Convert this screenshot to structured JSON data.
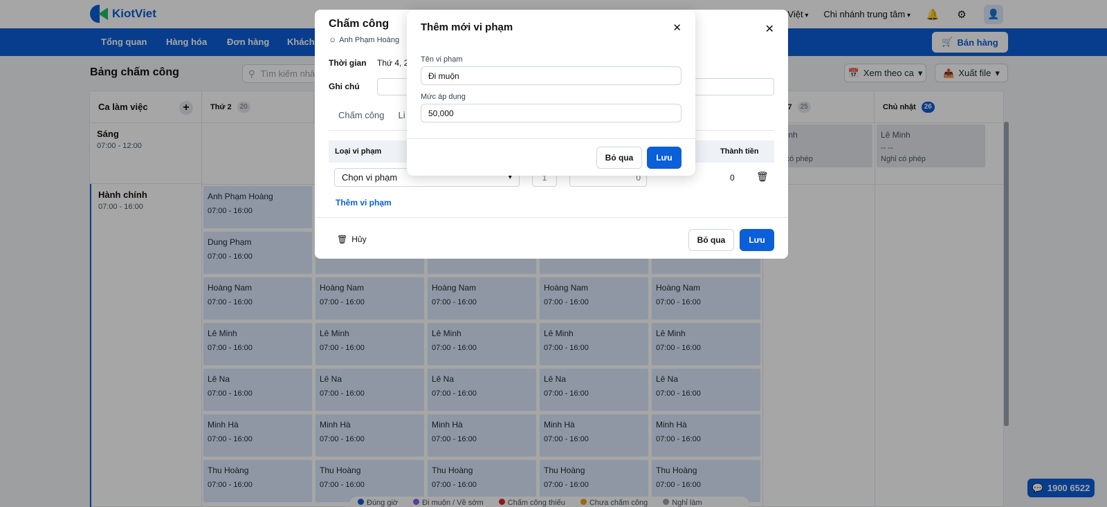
{
  "app": {
    "logo": "KiotViet"
  },
  "topbar": {
    "language": "Tiếng Việt",
    "branch": "Chi nhánh trung tâm"
  },
  "nav": {
    "items": [
      "Tổng quan",
      "Hàng hóa",
      "Đơn hàng",
      "Khách"
    ],
    "sell_label": "Bán hàng"
  },
  "page": {
    "title": "Bảng chấm công",
    "search_placeholder": "Tìm kiếm nhân viên",
    "view_label": "Xem theo ca",
    "export_label": "Xuất file"
  },
  "grid": {
    "shift_header": "Ca làm việc",
    "days": [
      {
        "label": "Thứ 2",
        "num": "20"
      },
      {
        "label": "Thứ 7",
        "num": "25"
      },
      {
        "label": "Chủ nhật",
        "num": "26"
      }
    ],
    "shifts": [
      {
        "name": "Sáng",
        "time": "07:00 - 12:00"
      },
      {
        "name": "Hành chính",
        "time": "07:00 - 16:00"
      }
    ],
    "morning_cells": [
      {
        "name": "Lê Minh",
        "dash": "-- --",
        "status": "Nghỉ có phép"
      },
      {
        "name": "Lê Minh",
        "dash": "-- --",
        "status": "Nghỉ có phép"
      }
    ],
    "employees": [
      "Anh Phạm Hoàng",
      "Dung Phạm",
      "Hoàng Nam",
      "Lê Minh",
      "Lê Na",
      "Minh Hà",
      "Thu Hoàng"
    ],
    "shift_time": "07:00 - 16:00"
  },
  "legend": [
    "Đúng giờ",
    "Đi muộn / Về sớm",
    "Chấm công thiếu",
    "Chưa chấm công",
    "Nghỉ làm"
  ],
  "hotline": "1900 6522",
  "timesheet_dialog": {
    "title": "Chấm công",
    "user": "Anh Phạm Hoàng",
    "time_label": "Thời gian",
    "time_value": "Thứ 4, 2",
    "note_label": "Ghi chú",
    "tabs": [
      "Chấm công",
      "Li"
    ],
    "col_type": "Loại vi phạm",
    "col_total": "Thành tiền",
    "select_placeholder": "Chọn vi phạm",
    "qty": "1",
    "amount": "0",
    "total": "0",
    "add_violation": "Thêm vi phạm",
    "cancel_label": "Hủy",
    "skip_label": "Bỏ qua",
    "save_label": "Lưu"
  },
  "violation_dialog": {
    "title": "Thêm mới vi phạm",
    "name_label": "Tên vi phạm",
    "name_value": "Đi muộn",
    "rate_label": "Mức áp dụng",
    "rate_value": "50,000",
    "skip_label": "Bỏ qua",
    "save_label": "Lưu"
  },
  "colors": {
    "primary": "#0b5fd8",
    "cell": "#dbe8fb"
  }
}
